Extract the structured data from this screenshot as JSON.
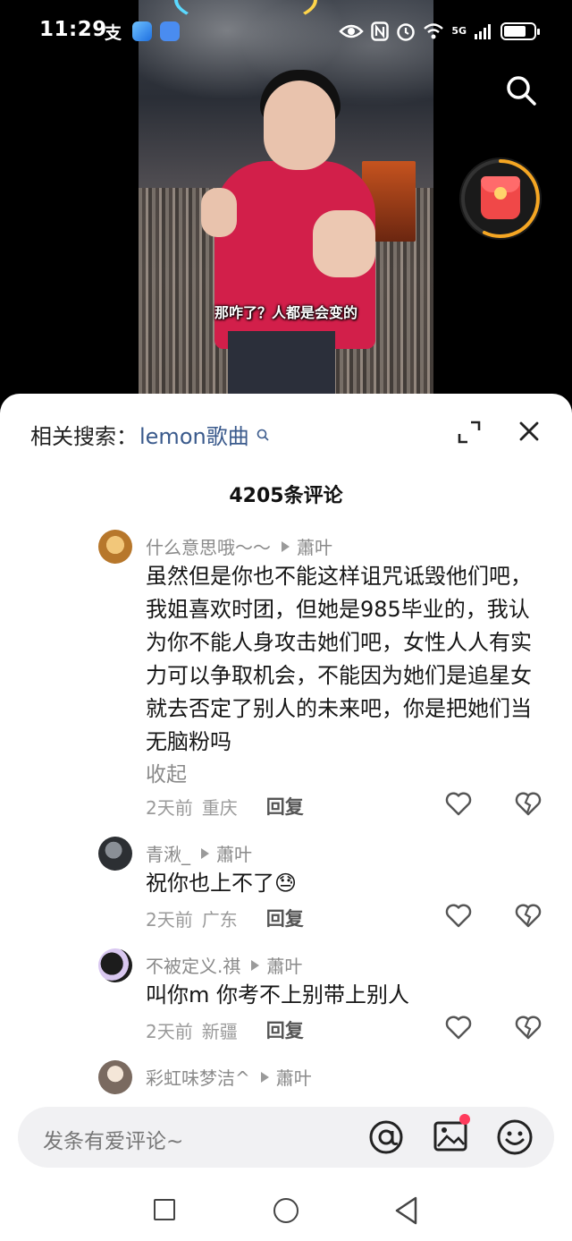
{
  "status_bar": {
    "time": "11:29",
    "left_glyph": "支",
    "network": "5G",
    "icons": [
      "alipay-icon",
      "app-badge-icon",
      "eye-icon",
      "nfc-icon",
      "alarm-icon",
      "wifi-icon",
      "signal-icon",
      "battery-icon"
    ],
    "battery_level": 0.75
  },
  "video": {
    "subtitle": "那咋了？人都是会变的"
  },
  "comments_panel": {
    "related_label": "相关搜索：",
    "related_keyword": "lemon歌曲",
    "count_title": "4205条评论",
    "replies": [
      {
        "author": "什么意思哦～～",
        "reply_to": "蕭叶",
        "text": "虽然但是你也不能这样诅咒诋毁他们吧，我姐喜欢时团，但她是985毕业的，我认为你不能人身攻击她们吧，女性人人有实力可以争取机会，不能因为她们是追星女就去否定了别人的未来吧，你是把她们当无脑粉吗",
        "collapse_label": "收起",
        "time": "2天前",
        "location": "重庆",
        "reply_label": "回复"
      },
      {
        "author": "青湫_",
        "reply_to": "蕭叶",
        "text": "祝你也上不了😓",
        "time": "2天前",
        "location": "广东",
        "reply_label": "回复"
      },
      {
        "author": "不被定义.祺",
        "reply_to": "蕭叶",
        "text": "叫你m 你考不上别带上别人",
        "time": "2天前",
        "location": "新疆",
        "reply_label": "回复"
      },
      {
        "author": "彩虹味梦洁^",
        "reply_to": "蕭叶"
      }
    ],
    "composer_placeholder": "发条有爱评论~"
  },
  "colors": {
    "link_blue": "#3a5a8c",
    "video_shirt": "#d21f4a",
    "red_packet": "#f04848",
    "progress_ring": "#f5a623",
    "notification_dot": "#ff3b5c"
  }
}
